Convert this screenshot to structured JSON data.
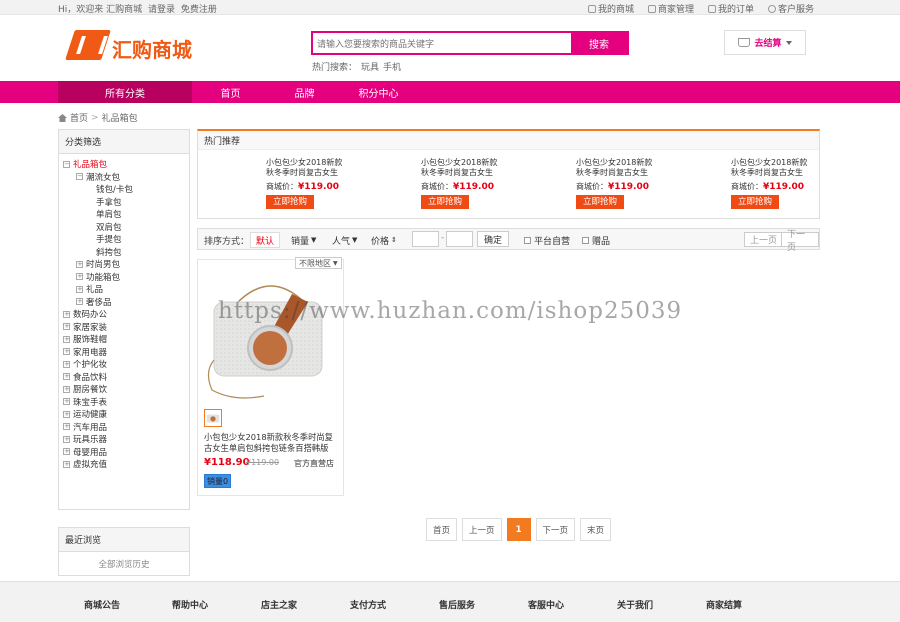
{
  "topbar": {
    "welcome": "Hi，欢迎来 汇购商城",
    "login": "请登录",
    "register": "免费注册",
    "links": [
      {
        "icon": "home-icon",
        "label": "我的商城"
      },
      {
        "icon": "shop-icon",
        "label": "商家管理"
      },
      {
        "icon": "order-icon",
        "label": "我的订单"
      },
      {
        "icon": "service-icon",
        "label": "客户服务"
      }
    ]
  },
  "header": {
    "logo_text": "汇购商城",
    "search_placeholder": "请输入您要搜索的商品关键字",
    "search_button": "搜索",
    "hot_label": "热门搜索：",
    "hot_terms": [
      "玩具",
      "手机"
    ],
    "cart_label": "去结算"
  },
  "nav": {
    "all_categories": "所有分类",
    "items": [
      "首页",
      "品牌",
      "积分中心"
    ]
  },
  "breadcrumb": {
    "home": "首页",
    "sep": ">",
    "current": "礼品箱包"
  },
  "sidebar": {
    "title": "分类筛选",
    "tree": [
      {
        "label": "礼品箱包",
        "level": 0,
        "sign": "−",
        "active": true
      },
      {
        "label": "潮流女包",
        "level": 1,
        "sign": "−"
      },
      {
        "label": "钱包/卡包",
        "level": 2
      },
      {
        "label": "手拿包",
        "level": 2
      },
      {
        "label": "单肩包",
        "level": 2
      },
      {
        "label": "双肩包",
        "level": 2
      },
      {
        "label": "手提包",
        "level": 2
      },
      {
        "label": "斜挎包",
        "level": 2
      },
      {
        "label": "时尚男包",
        "level": 1,
        "sign": "+"
      },
      {
        "label": "功能箱包",
        "level": 1,
        "sign": "+"
      },
      {
        "label": "礼品",
        "level": 1,
        "sign": "+"
      },
      {
        "label": "奢侈品",
        "level": 1,
        "sign": "+"
      },
      {
        "label": "数码办公",
        "level": 0,
        "sign": "+"
      },
      {
        "label": "家居家装",
        "level": 0,
        "sign": "+"
      },
      {
        "label": "服饰鞋帽",
        "level": 0,
        "sign": "+"
      },
      {
        "label": "家用电器",
        "level": 0,
        "sign": "+"
      },
      {
        "label": "个护化妆",
        "level": 0,
        "sign": "+"
      },
      {
        "label": "食品饮料",
        "level": 0,
        "sign": "+"
      },
      {
        "label": "厨房餐饮",
        "level": 0,
        "sign": "+"
      },
      {
        "label": "珠宝手表",
        "level": 0,
        "sign": "+"
      },
      {
        "label": "运动健康",
        "level": 0,
        "sign": "+"
      },
      {
        "label": "汽车用品",
        "level": 0,
        "sign": "+"
      },
      {
        "label": "玩具乐器",
        "level": 0,
        "sign": "+"
      },
      {
        "label": "母婴用品",
        "level": 0,
        "sign": "+"
      },
      {
        "label": "虚拟充值",
        "level": 0,
        "sign": "+"
      }
    ],
    "recent_title": "最近浏览",
    "recent_link": "全部浏览历史"
  },
  "hot": {
    "title": "热门推荐",
    "price_label": "商城价：",
    "buy_label": "立即抢购",
    "items": [
      {
        "name1": "小包包少女2018新款",
        "name2": "秋冬季时尚复古女生",
        "price": "¥119.00"
      },
      {
        "name1": "小包包少女2018新款",
        "name2": "秋冬季时尚复古女生",
        "price": "¥119.00"
      },
      {
        "name1": "小包包少女2018新款",
        "name2": "秋冬季时尚复古女生",
        "price": "¥119.00"
      },
      {
        "name1": "小包包少女2018新款",
        "name2": "秋冬季时尚复古女生",
        "price": "¥119.00"
      }
    ]
  },
  "sortbar": {
    "label": "排序方式：",
    "options": [
      "默认",
      "销量",
      "人气",
      "价格"
    ],
    "range_sep": "-",
    "confirm": "确定",
    "self_run": "平台自营",
    "gift": "赠品",
    "prev": "上一页",
    "next": "下一页"
  },
  "product": {
    "region": "不限地区",
    "title": "小包包少女2018新款秋冬季时尚复古女生单肩包斜挎包链条百搭韩版",
    "price": "¥118.90",
    "old_price": "¥119.00",
    "shop": "官方直营店",
    "sales": "销量0"
  },
  "pager": [
    "首页",
    "上一页",
    "1",
    "下一页",
    "末页"
  ],
  "footer": [
    "商城公告",
    "帮助中心",
    "店主之家",
    "支付方式",
    "售后服务",
    "客服中心",
    "关于我们",
    "商家结算"
  ],
  "watermark": "https://www.huzhan.com/ishop25039",
  "colors": {
    "brand": "#e4007f",
    "accent": "#f27b21",
    "price": "#e60012",
    "logo": "#f05a14"
  }
}
